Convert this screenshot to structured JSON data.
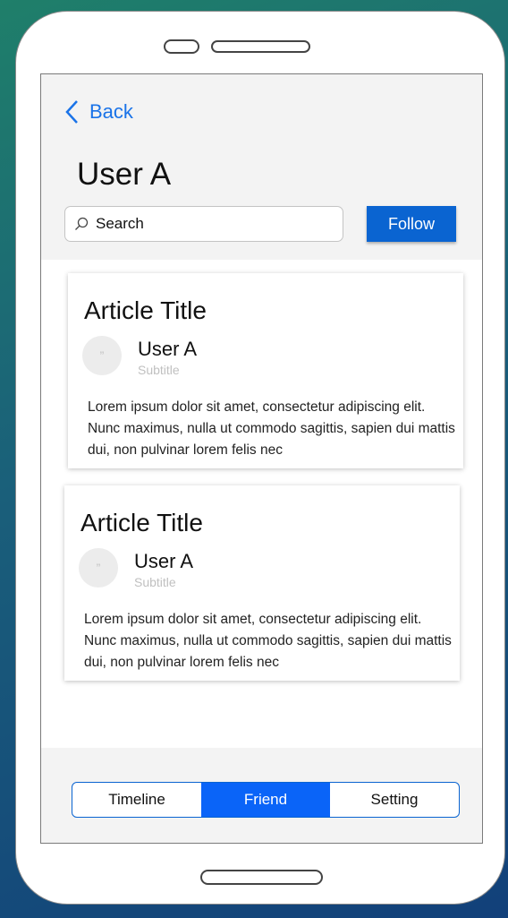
{
  "header": {
    "back_label": "Back",
    "title": "User A",
    "search_placeholder": "Search",
    "follow_label": "Follow"
  },
  "articles": [
    {
      "title": "Article Title",
      "avatar_text": "”",
      "author": "User A",
      "subtitle": "Subtitle",
      "body": "Lorem ipsum dolor sit amet, consectetur adipiscing elit. Nunc maximus, nulla ut commodo sagittis, sapien dui mattis dui, non pulvinar lorem felis nec"
    },
    {
      "title": "Article Title",
      "avatar_text": "”",
      "author": "User A",
      "subtitle": "Subtitle",
      "body": "Lorem ipsum dolor sit amet, consectetur adipiscing elit. Nunc maximus, nulla ut commodo sagittis, sapien dui mattis dui, non pulvinar lorem felis nec"
    }
  ],
  "tabs": [
    {
      "label": "Timeline",
      "active": false
    },
    {
      "label": "Friend",
      "active": true
    },
    {
      "label": "Setting",
      "active": false
    }
  ],
  "colors": {
    "accent": "#0a64d1",
    "link": "#1a73e8"
  }
}
